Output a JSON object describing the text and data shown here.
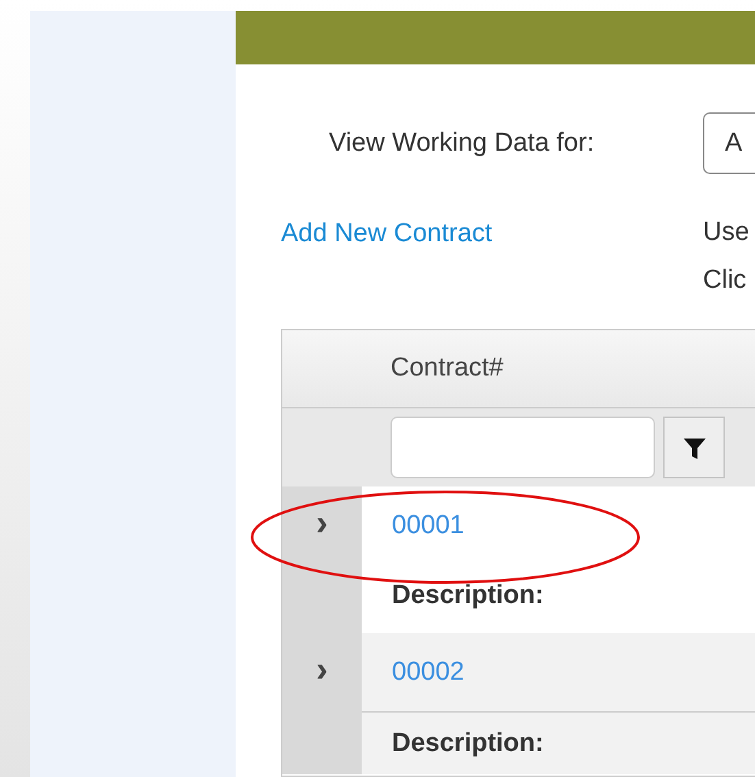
{
  "filter_bar": {
    "label": "View Working Data for:",
    "select_value": "A"
  },
  "add_link": "Add New Contract",
  "instructions": [
    "Use",
    "Clic"
  ],
  "grid": {
    "columns": [
      "Contract#"
    ],
    "rows": [
      {
        "number": "00001",
        "description_label": "Description:",
        "expand_glyph": "›",
        "highlighted": true,
        "alt": false
      },
      {
        "number": "00002",
        "description_label": "Description:",
        "expand_glyph": "›",
        "highlighted": false,
        "alt": true
      }
    ]
  }
}
